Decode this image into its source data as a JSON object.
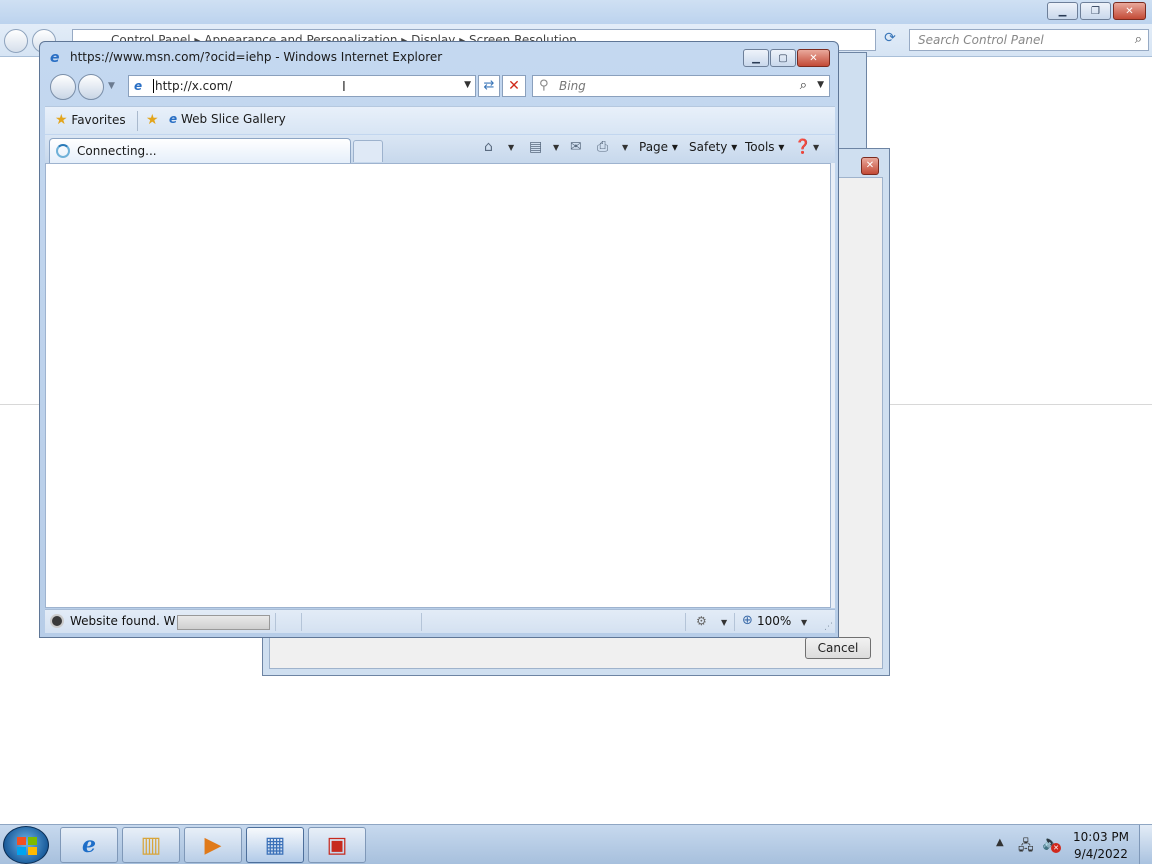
{
  "control_panel": {
    "breadcrumb": [
      "Control Panel",
      "Appearance and Personalization",
      "Display",
      "Screen Resolution"
    ],
    "search_placeholder": "Search Control Panel",
    "cancel_label": "Cancel"
  },
  "ie": {
    "title": "https://www.msn.com/?ocid=iehp - Windows Internet Explorer",
    "address": "http://x.com/",
    "search_placeholder": "Bing",
    "favorites_label": "Favorites",
    "web_slice_label": "Web Slice Gallery",
    "tab_label": "Connecting...",
    "commands": {
      "page": "Page",
      "safety": "Safety",
      "tools": "Tools"
    },
    "status_text": "Website found. Waiting for reply...",
    "zoom": "100%"
  },
  "taskbar": {
    "time": "10:03 PM",
    "date": "9/4/2022",
    "apps": [
      "internet-explorer",
      "windows-explorer",
      "media-player",
      "control-panel",
      "toolbox"
    ]
  },
  "colors": {
    "titlebar": "#c4d8f0",
    "close_button": "#c34a36",
    "taskbar": "#b7cde8"
  }
}
